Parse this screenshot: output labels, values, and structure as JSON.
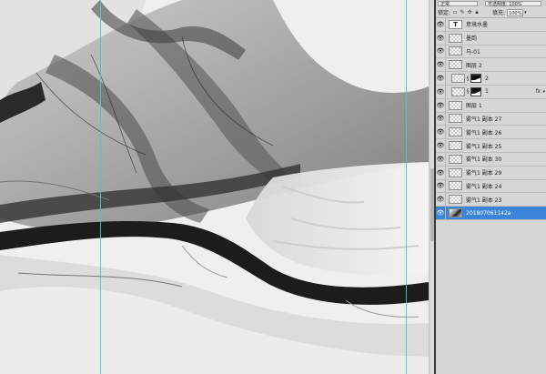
{
  "panel": {
    "blend_mode": "正常",
    "opacity_label": "不透明度: 100%",
    "lock_label": "锁定:",
    "fill_label": "填充:",
    "fill_value": "100%"
  },
  "layers": [
    {
      "name": "意境水墨",
      "thumb": "text",
      "thumb_glyph": "T"
    },
    {
      "name": "墨韵",
      "thumb": "check"
    },
    {
      "name": "马-01",
      "thumb": "check"
    },
    {
      "name": "图层 2",
      "thumb": "check"
    },
    {
      "name": "2",
      "thumb": "check",
      "mask": true
    },
    {
      "name": "1",
      "thumb": "check",
      "mask": true,
      "fx": "fx"
    },
    {
      "name": "图层 1",
      "thumb": "check"
    },
    {
      "name": "雾气1 副本 27",
      "thumb": "check"
    },
    {
      "name": "雾气1 副本 26",
      "thumb": "check"
    },
    {
      "name": "雾气1 副本 25",
      "thumb": "check"
    },
    {
      "name": "雾气1 副本 30",
      "thumb": "check"
    },
    {
      "name": "雾气1 副本 29",
      "thumb": "check"
    },
    {
      "name": "雾气1 副本 24",
      "thumb": "check"
    },
    {
      "name": "雾气1 副本 23",
      "thumb": "check"
    },
    {
      "name": "20180706114​2a",
      "thumb": "image",
      "selected": true
    }
  ],
  "icons": {
    "eye": "eye-icon",
    "lock_pixels": "lock-pixels-icon",
    "lock_paint": "lock-paint-icon",
    "lock_move": "lock-move-icon",
    "lock_all": "lock-all-icon",
    "chain": "chain-icon"
  },
  "colors": {
    "selected_row": "#3a85d9",
    "guide": "#2fd0e0",
    "panel_bg": "#d6d6d6"
  }
}
